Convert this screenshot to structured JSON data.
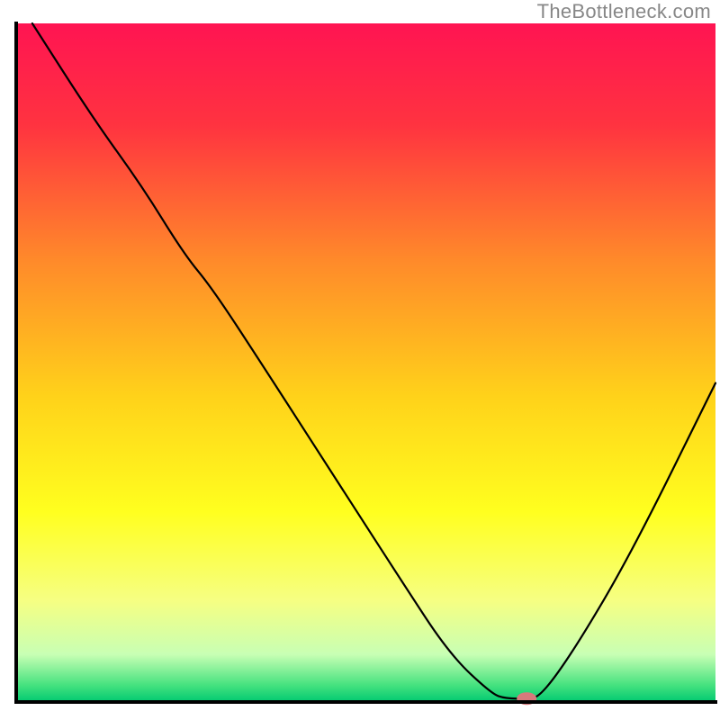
{
  "watermark": "TheBottleneck.com",
  "chart_data": {
    "type": "line",
    "title": "",
    "xlabel": "",
    "ylabel": "",
    "xlim": [
      0,
      100
    ],
    "ylim": [
      0,
      100
    ],
    "grid": false,
    "legend": false,
    "gradient_stops": [
      {
        "offset": 0.0,
        "color": "#ff1452"
      },
      {
        "offset": 0.15,
        "color": "#ff3340"
      },
      {
        "offset": 0.35,
        "color": "#ff8a2a"
      },
      {
        "offset": 0.55,
        "color": "#ffd21a"
      },
      {
        "offset": 0.72,
        "color": "#ffff1f"
      },
      {
        "offset": 0.85,
        "color": "#f6ff82"
      },
      {
        "offset": 0.93,
        "color": "#c8ffb4"
      },
      {
        "offset": 0.975,
        "color": "#46e27f"
      },
      {
        "offset": 1.0,
        "color": "#00c971"
      }
    ],
    "axis": {
      "x0": 18,
      "x1": 795,
      "y_top": 26,
      "y_bottom": 780,
      "stroke": "#000000",
      "width": 4
    },
    "series": [
      {
        "name": "bottleneck-curve",
        "stroke": "#000000",
        "width": 2.2,
        "x": [
          2.3,
          11,
          18,
          24,
          28,
          35,
          45,
          55,
          62,
          68,
          70,
          73,
          75,
          80,
          88,
          100
        ],
        "y": [
          100,
          86,
          76,
          66,
          61,
          50,
          34,
          18,
          7,
          1.2,
          0.5,
          0.5,
          0.8,
          8,
          22,
          47
        ]
      }
    ],
    "marker": {
      "name": "optimal-point",
      "x": 73,
      "y": 0.5,
      "color": "#d6797c",
      "rx": 11,
      "ry": 7
    }
  }
}
